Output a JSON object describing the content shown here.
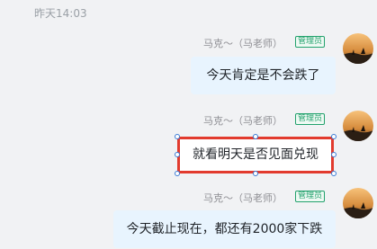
{
  "timestamp": "昨天14:03",
  "messages": [
    {
      "sender": "马克～（马老师）",
      "role_badge": "管理员",
      "text": "今天肯定是不会跌了"
    },
    {
      "sender": "马克～（马老师）",
      "role_badge": "管理员",
      "text": "就看明天是否见面兑现",
      "selected": true
    },
    {
      "sender": "马克～（马老师）",
      "role_badge": "管理员",
      "text": "今天截止现在，都还有2000家下跌"
    }
  ],
  "colors": {
    "background": "#f1f2f4",
    "bubble": "#e8f4fe",
    "selection_border": "#e23b2e",
    "handle": "#3a7bd5",
    "badge": "#23a26d"
  },
  "icons": {
    "avatar": "sunset-silhouette-avatar"
  }
}
